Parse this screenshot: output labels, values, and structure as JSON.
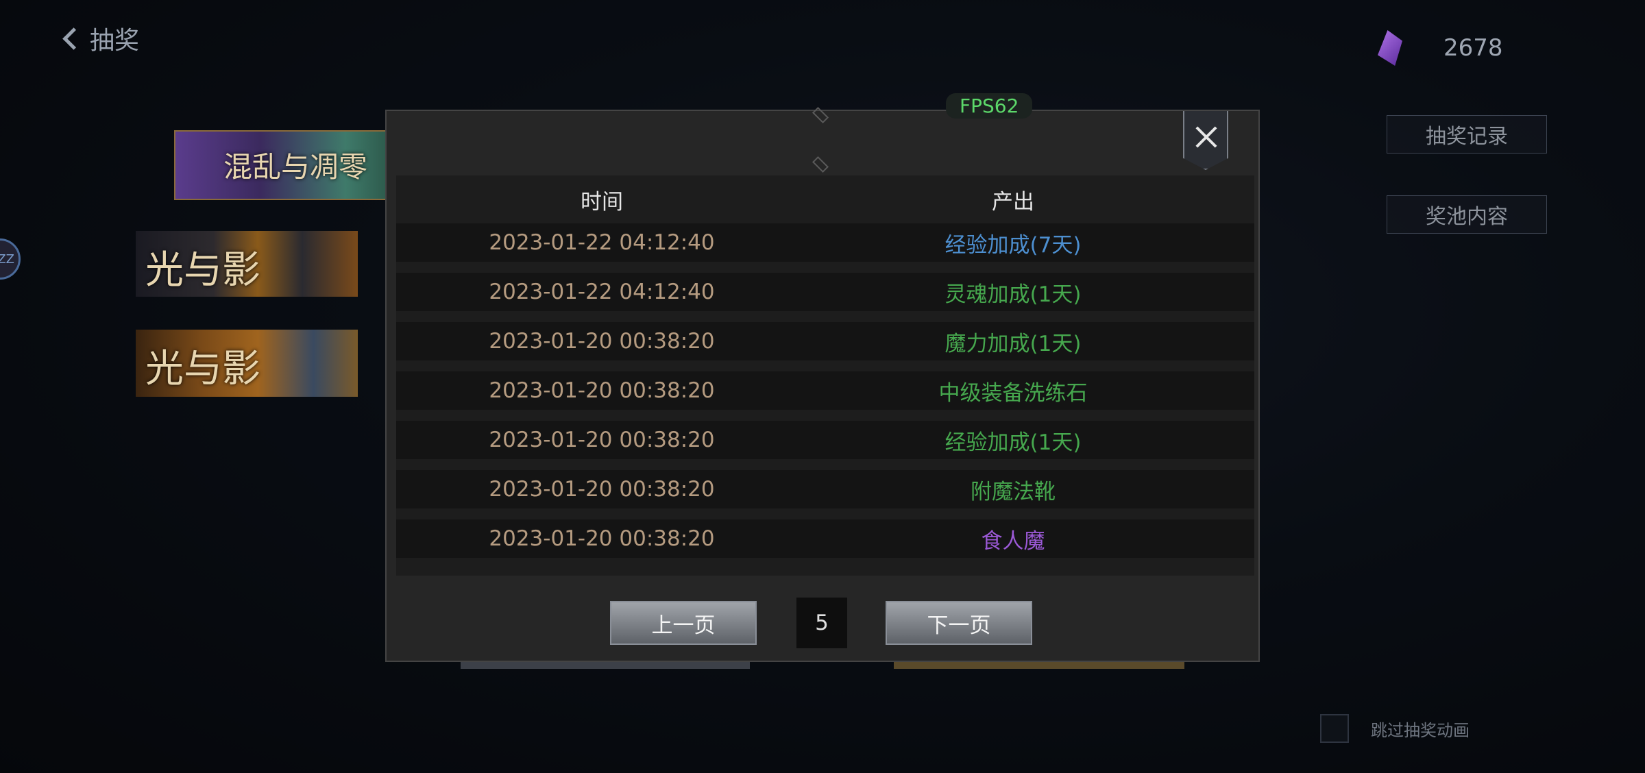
{
  "header": {
    "back_label": "抽奖"
  },
  "currency": {
    "icon": "purple-crystal-icon",
    "amount": "2678"
  },
  "side_buttons": {
    "draw_record": "抽奖记录",
    "pool_content": "奖池内容"
  },
  "skip": {
    "label": "跳过抽奖动画"
  },
  "avatar": {
    "label": "ZZ"
  },
  "banners": [
    {
      "text": "混乱与凋零"
    },
    {
      "text": "光与影"
    },
    {
      "text": "光与影"
    }
  ],
  "fps": "FPS62",
  "dialog": {
    "columns": {
      "time": "时间",
      "output": "产出"
    },
    "rows": [
      {
        "time": "2023-01-22 04:12:40",
        "output": "经验加成(7天)",
        "color": "#4d8fd0"
      },
      {
        "time": "2023-01-22 04:12:40",
        "output": "灵魂加成(1天)",
        "color": "#46a84e"
      },
      {
        "time": "2023-01-20 00:38:20",
        "output": "魔力加成(1天)",
        "color": "#46a84e"
      },
      {
        "time": "2023-01-20 00:38:20",
        "output": "中级装备洗练石",
        "color": "#46a84e"
      },
      {
        "time": "2023-01-20 00:38:20",
        "output": "经验加成(1天)",
        "color": "#46a84e"
      },
      {
        "time": "2023-01-20 00:38:20",
        "output": "附魔法靴",
        "color": "#46a84e"
      },
      {
        "time": "2023-01-20 00:38:20",
        "output": "食人魔",
        "color": "#9b59d6"
      }
    ],
    "pager": {
      "prev": "上一页",
      "page": "5",
      "next": "下一页"
    }
  }
}
